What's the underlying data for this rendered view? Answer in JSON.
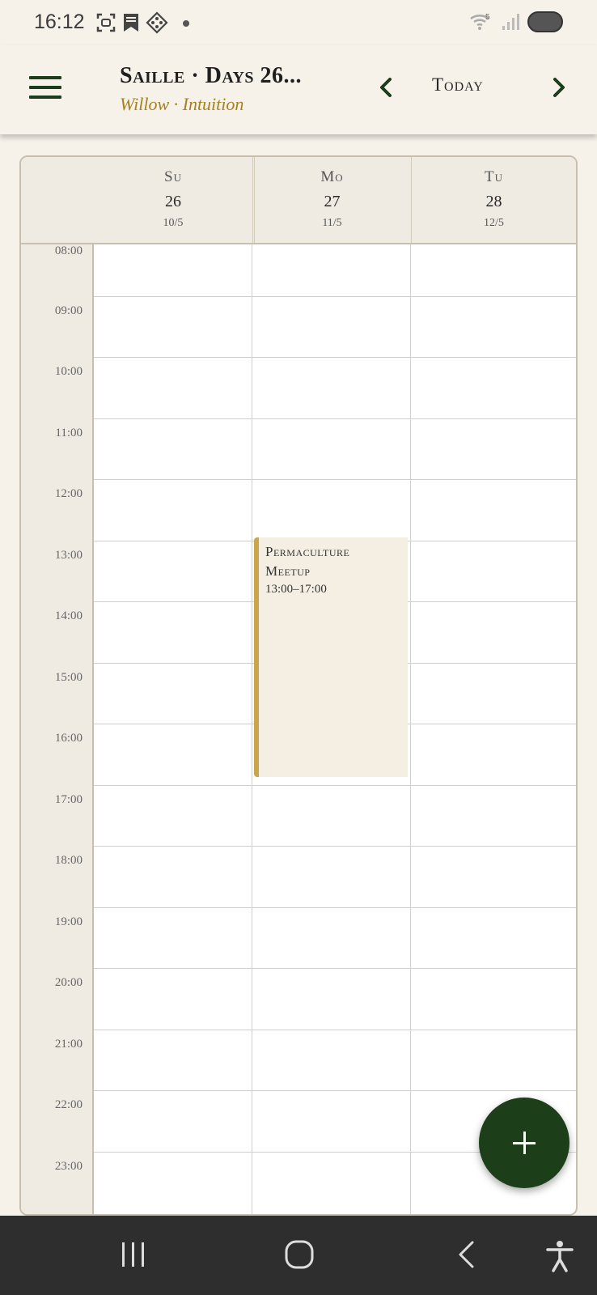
{
  "status_bar": {
    "time": "16:12",
    "icons": [
      "screenshot-icon",
      "bookmark-icon",
      "app-icon",
      "notification-dot",
      "wifi-icon",
      "signal-icon",
      "battery-icon"
    ],
    "wifi_label": "5"
  },
  "header": {
    "title": "Saille · Days 26...",
    "subtitle": "Willow · Intuition",
    "today_label": "Today",
    "icons": [
      "menu-icon",
      "chevron-left-icon",
      "chevron-right-icon"
    ]
  },
  "days": [
    {
      "name": "Su",
      "number": "26",
      "date": "10/5"
    },
    {
      "name": "Mo",
      "number": "27",
      "date": "11/5"
    },
    {
      "name": "Tu",
      "number": "28",
      "date": "12/5"
    }
  ],
  "hours": [
    "08:00",
    "09:00",
    "10:00",
    "11:00",
    "12:00",
    "13:00",
    "14:00",
    "15:00",
    "16:00",
    "17:00",
    "18:00",
    "19:00",
    "20:00",
    "21:00",
    "22:00",
    "23:00"
  ],
  "events": [
    {
      "title_line1": "Permaculture",
      "title_line2": "Meetup",
      "time": "13:00–17:00",
      "day": "Mo"
    }
  ],
  "fab": {
    "icon": "plus-icon"
  },
  "navigation_bar": {
    "icons": [
      "recents-icon",
      "home-icon",
      "back-icon",
      "accessibility-icon"
    ]
  },
  "colors": {
    "accent": "#1c3f1a",
    "gold": "#a8801c",
    "event_bar": "#c9a64e",
    "background": "#f6f2ea"
  }
}
